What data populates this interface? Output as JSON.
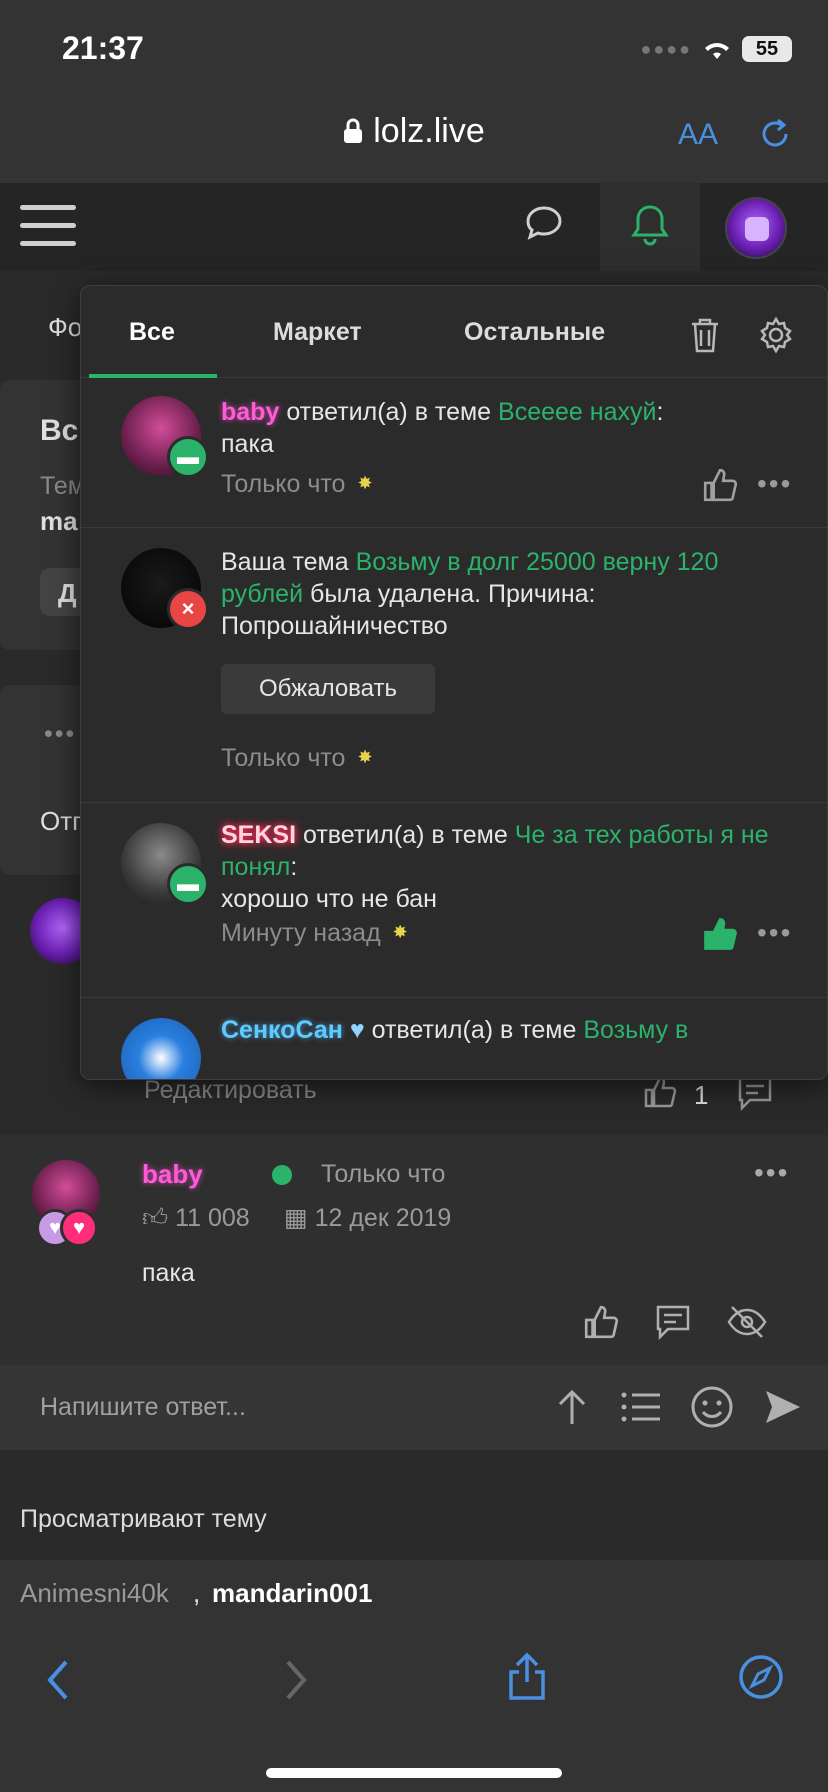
{
  "status_bar": {
    "time": "21:37",
    "battery": "55"
  },
  "browser": {
    "url": "lolz.live",
    "text_size_label": "AA"
  },
  "background_page": {
    "left_labels": [
      "Фо",
      "Вс",
      "Тем",
      "ma",
      "Д",
      "Отп"
    ],
    "post": {
      "author": "baby",
      "time": "Только что",
      "likes": "11 008",
      "date": "12 дек 2019",
      "body": "пака"
    },
    "prev_post": {
      "edit_label": "Редактировать",
      "like_count": "1"
    },
    "reply_placeholder": "Напишите ответ...",
    "viewing_title": "Просматривают тему",
    "viewers": [
      "Animesni40k",
      "mandarin001"
    ],
    "viewers_separator": ","
  },
  "popup": {
    "tabs": [
      "Все",
      "Маркет",
      "Остальные"
    ],
    "notifications": [
      {
        "user": "baby",
        "action": "ответил(а) в теме",
        "thread": "Всееее нахуй",
        "message": "пака",
        "time": "Только что"
      },
      {
        "prefix": "Ваша тема",
        "thread": "Возьму в долг 25000 верну 120 рублей",
        "suffix": "была удалена. Причина: Попрошайничество",
        "button": "Обжаловать",
        "time": "Только что"
      },
      {
        "user": "SEKSI",
        "action": "ответил(а) в теме",
        "thread": "Че за тех работы я не понял",
        "message": "хорошо что не бан",
        "time": "Минуту назад"
      },
      {
        "user": "СенкоСан",
        "action": "ответил(а) в теме",
        "thread": "Возьму в"
      }
    ]
  },
  "colors": {
    "accent": "#2bb36b",
    "link": "#4a90e2",
    "background": "#2a2a2a"
  }
}
